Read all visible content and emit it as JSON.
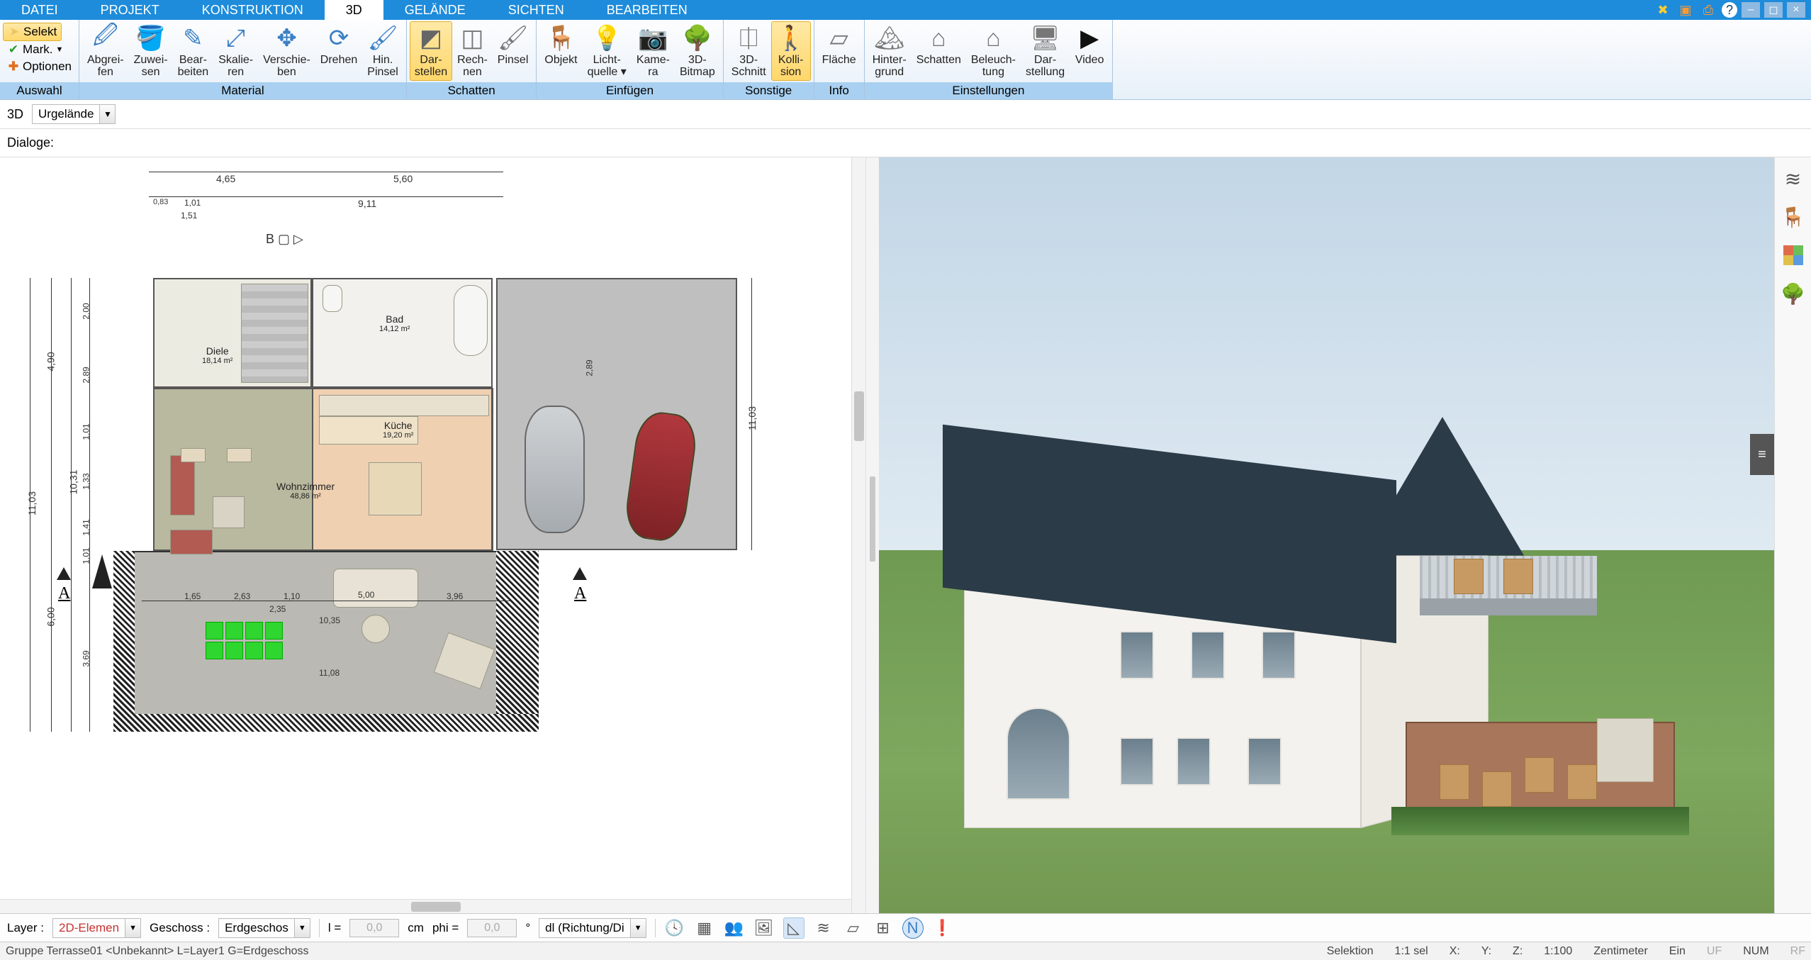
{
  "menu": {
    "items": [
      "DATEI",
      "PROJEKT",
      "KONSTRUKTION",
      "3D",
      "GELÄNDE",
      "SICHTEN",
      "BEARBEITEN"
    ],
    "active": "3D"
  },
  "title_icons": {
    "wrench": "wrench-icon",
    "save": "save-icon",
    "print": "print-icon",
    "help": "help-icon",
    "min": "–",
    "max": "◻",
    "close": "×"
  },
  "ribbon": {
    "groups": {
      "auswahl": {
        "label": "Auswahl",
        "selekt": "Selekt",
        "mark": "Mark.",
        "optionen": "Optionen"
      },
      "material": {
        "label": "Material",
        "abgreifen": {
          "l1": "Abgrei-",
          "l2": "fen"
        },
        "zuweisen": {
          "l1": "Zuwei-",
          "l2": "sen"
        },
        "bearbeiten": {
          "l1": "Bear-",
          "l2": "beiten"
        },
        "skalieren": {
          "l1": "Skalie-",
          "l2": "ren"
        },
        "verschieben": {
          "l1": "Verschie-",
          "l2": "ben"
        },
        "drehen": {
          "l1": "Drehen",
          "l2": ""
        },
        "hinpinsel": {
          "l1": "Hin.",
          "l2": "Pinsel"
        }
      },
      "schatten": {
        "label": "Schatten",
        "darstellen": {
          "l1": "Dar-",
          "l2": "stellen"
        },
        "rechnen": {
          "l1": "Rech-",
          "l2": "nen"
        },
        "pinsel": {
          "l1": "Pinsel",
          "l2": ""
        }
      },
      "einfuegen": {
        "label": "Einfügen",
        "objekt": {
          "l1": "Objekt",
          "l2": ""
        },
        "lichtquelle": {
          "l1": "Licht-",
          "l2": "quelle ▾"
        },
        "kamera": {
          "l1": "Kame-",
          "l2": "ra"
        },
        "bitmap": {
          "l1": "3D-",
          "l2": "Bitmap"
        }
      },
      "sonstige": {
        "label": "Sonstige",
        "schnitt": {
          "l1": "3D-",
          "l2": "Schnitt"
        },
        "kollision": {
          "l1": "Kolli-",
          "l2": "sion"
        }
      },
      "info": {
        "label": "Info",
        "flaeche": {
          "l1": "Fläche",
          "l2": ""
        }
      },
      "einstellungen": {
        "label": "Einstellungen",
        "hintergrund": {
          "l1": "Hinter-",
          "l2": "grund"
        },
        "schatten": {
          "l1": "Schatten",
          "l2": ""
        },
        "beleuchtung": {
          "l1": "Beleuch-",
          "l2": "tung"
        },
        "darstellung": {
          "l1": "Dar-",
          "l2": "stellung"
        },
        "video": {
          "l1": "Video",
          "l2": ""
        }
      }
    }
  },
  "subbar": {
    "view_mode": "3D",
    "terrain": "Urgelände"
  },
  "dialoge_label": "Dialoge:",
  "floorplan": {
    "rooms": {
      "bad": {
        "name": "Bad",
        "area": "14,12 m²"
      },
      "diele": {
        "name": "Diele",
        "area": "18,14 m²"
      },
      "kueche": {
        "name": "Küche",
        "area": "19,20 m²"
      },
      "wohnzimmer": {
        "name": "Wohnzimmer",
        "area": "48,86 m²"
      }
    },
    "section_markers": {
      "a": "A",
      "b": "B"
    },
    "dims": {
      "top_left": "4,65",
      "top_right": "5,60",
      "top2": "9,11",
      "top2_small_l": "0,83",
      "top2_mid_l": "1,01",
      "top2_mid_s": "1,51",
      "left_total": "11,03",
      "left_up": "4,90",
      "left_mid": "10,31",
      "left_low": "6,00",
      "left_s1": "2,00",
      "left_s2": "2,89",
      "left_s3": "1,01",
      "left_s4": "1,33",
      "left_s5": "1,41",
      "left_s6": "1,01",
      "left_s7": "3,69",
      "gar_right": "11,03",
      "gar_seg": "2,89",
      "ter_l": "1,65",
      "ter_m1": "2,63",
      "ter_m2": "1,10",
      "ter_sum": "5,00",
      "ter_mid": "2,35",
      "ter_r": "3,96",
      "ter_total": "10,35",
      "ter_total2": "11,08"
    }
  },
  "right_tools": [
    "layers-icon",
    "furniture-icon",
    "materials-icon",
    "plants-icon"
  ],
  "bottom": {
    "layer_lbl": "Layer :",
    "layer_val": "2D-Elemen",
    "geschoss_lbl": "Geschoss :",
    "geschoss_val": "Erdgeschos",
    "l_lbl": "l =",
    "l_val": "0,0",
    "l_unit": "cm",
    "phi_lbl": "phi =",
    "phi_val": "0,0",
    "phi_unit": "°",
    "dl_val": "dl (Richtung/Di",
    "icons": [
      "clock-icon",
      "grid-icon",
      "users-icon",
      "photo-icon",
      "triangle-icon",
      "stack-icon",
      "plane-icon",
      "hash-grid-icon",
      "north-icon",
      "info-icon"
    ]
  },
  "status": {
    "left": "Gruppe Terrasse01 <Unbekannt> L=Layer1 G=Erdgeschoss",
    "selektion": "Selektion",
    "ratio": "1:1 sel",
    "x": "X:",
    "y": "Y:",
    "z": "Z:",
    "scale": "1:100",
    "unit": "Zentimeter",
    "ein": "Ein",
    "uf": "UF",
    "num": "NUM",
    "rf": "RF"
  }
}
